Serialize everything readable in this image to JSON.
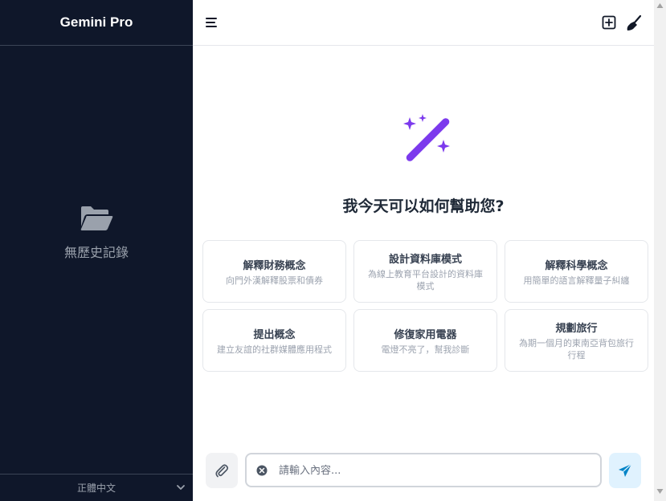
{
  "sidebar": {
    "title": "Gemini Pro",
    "empty_text": "無歷史記錄",
    "language": "正體中文"
  },
  "main": {
    "greeting": "我今天可以如何幫助您?",
    "cards": [
      {
        "title": "解釋財務概念",
        "desc": "向門外漢解釋股票和債券"
      },
      {
        "title": "設計資料庫模式",
        "desc": "為線上教育平台設計的資料庫模式"
      },
      {
        "title": "解釋科學概念",
        "desc": "用簡單的語言解釋量子糾纏"
      },
      {
        "title": "提出概念",
        "desc": "建立友誼的社群媒體應用程式"
      },
      {
        "title": "修復家用電器",
        "desc": "電燈不亮了，幫我診斷"
      },
      {
        "title": "規劃旅行",
        "desc": "為期一個月的東南亞背包旅行行程"
      }
    ],
    "input": {
      "placeholder": "請輸入內容...",
      "value": ""
    }
  },
  "icons": {
    "menu": "menu-icon",
    "new_chat": "plus-square-icon",
    "clear": "broom-icon",
    "folder": "folder-open-icon",
    "wand": "magic-wand-icon",
    "attach": "paperclip-icon",
    "clear_input": "x-circle-icon",
    "send": "paper-plane-icon",
    "language_dropdown": "chevron-down-icon"
  },
  "colors": {
    "sidebar_bg": "#0f172a",
    "accent_purple": "#7c3aed",
    "send_blue": "#0284c7"
  }
}
